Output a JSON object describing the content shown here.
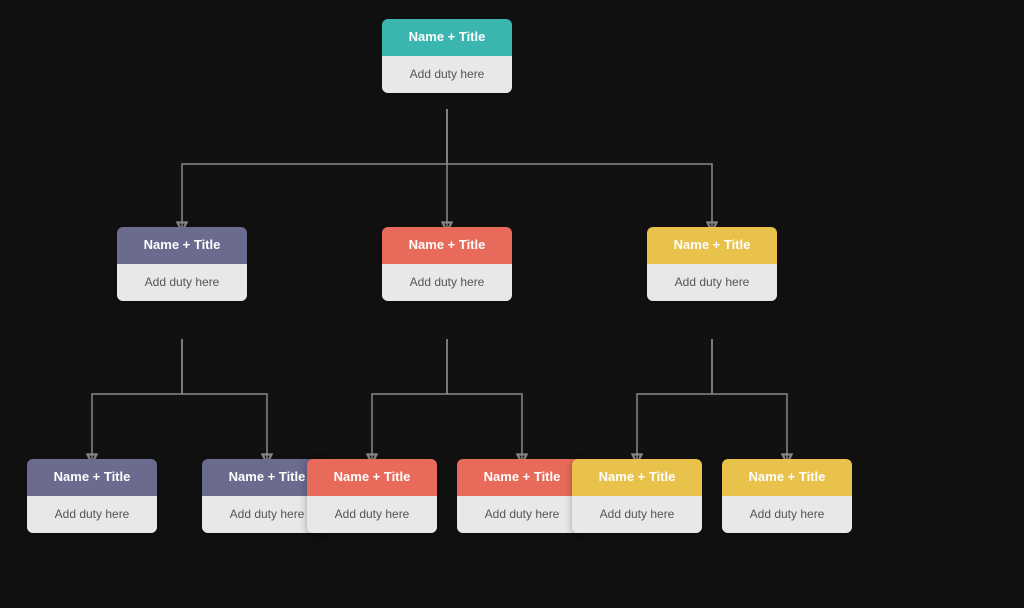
{
  "colors": {
    "teal": "#3ab5b0",
    "purple": "#6b6a8f",
    "coral": "#e86a5a",
    "yellow": "#e8c24a",
    "node_bg": "#e8e8e8",
    "line": "#888888"
  },
  "nodes": {
    "root": {
      "header": "Name + Title",
      "body": "Add duty here",
      "color": "teal"
    },
    "left": {
      "header": "Name + Title",
      "body": "Add duty here",
      "color": "purple"
    },
    "center": {
      "header": "Name + Title",
      "body": "Add duty here",
      "color": "coral"
    },
    "right": {
      "header": "Name + Title",
      "body": "Add duty here",
      "color": "yellow"
    },
    "ll": {
      "header": "Name + Title",
      "body": "Add duty here",
      "color": "purple"
    },
    "lr": {
      "header": "Name + Title",
      "body": "Add duty here",
      "color": "purple"
    },
    "cl": {
      "header": "Name + Title",
      "body": "Add duty here",
      "color": "coral"
    },
    "cr": {
      "header": "Name + Title",
      "body": "Add duty here",
      "color": "coral"
    },
    "rl": {
      "header": "Name + Title",
      "body": "Add duty here",
      "color": "yellow"
    },
    "rr": {
      "header": "Name + Title",
      "body": "Add duty here",
      "color": "yellow"
    }
  }
}
